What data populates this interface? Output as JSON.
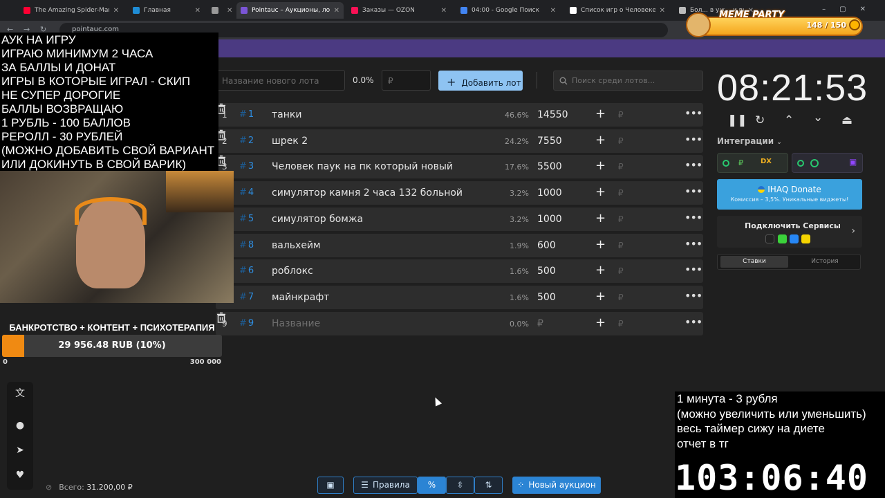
{
  "browser": {
    "tabs": [
      {
        "title": "The Amazing Spider-Man игра",
        "color": "#ff0033"
      },
      {
        "title": "Главная",
        "color": "#1f8dd6"
      },
      {
        "title": "",
        "color": "#999999"
      },
      {
        "title": "Pointauc – Аукционы, лотереи",
        "color": "#7b55d6",
        "active": true
      },
      {
        "title": "Заказы — OZON",
        "color": "#f91155"
      },
      {
        "title": "04:00 - Google Поиск",
        "color": "#4285f4"
      },
      {
        "title": "Список игр о Человеке-пауке",
        "color": "#ffffff"
      },
      {
        "title": "Бол... в уж... и выходные",
        "color": "#bbbbbb"
      }
    ],
    "url": "pointauc.com"
  },
  "overlay": {
    "lines": [
      "АУК НА ИГРУ",
      "ИГРАЮ МИНИМУМ 2 ЧАСА",
      "ЗА БАЛЛЫ И ДОНАТ",
      "ИГРЫ В КОТОРЫЕ ИГРАЛ - СКИП",
      "НЕ СУПЕР ДОРОГИЕ",
      "БАЛЛЫ ВОЗВРАЩАЮ",
      "1 РУБЛЬ - 100 БАЛЛОВ",
      "РЕРОЛЛ - 30 РУБЛЕЙ",
      "(МОЖНО ДОБАВИТЬ СВОЙ ВАРИАНТ",
      "ИЛИ ДОКИНУТЬ В СВОЙ ВАРИК)"
    ]
  },
  "donation_goal": {
    "title": "БАНКРОТСТВО + КОНТЕНТ + ПСИХОТЕРАПИЯ",
    "label": "29 956.48 RUB (10%)",
    "progress": 0.1,
    "min": "0",
    "max": "300 000"
  },
  "meme_party": {
    "title": "MEME PARTY",
    "count": "148 / 150"
  },
  "toolbar": {
    "new_lot_placeholder": "Название нового лота",
    "percent": "0.0%",
    "amount_placeholder": "₽",
    "add_lot": "Добавить лот",
    "search_placeholder": "Поиск среди лотов..."
  },
  "lots": [
    {
      "pos": "1",
      "id": "1",
      "name": "танки",
      "pct": "46.6%",
      "amount": "14550"
    },
    {
      "pos": "2",
      "id": "2",
      "name": "шрек 2",
      "pct": "24.2%",
      "amount": "7550"
    },
    {
      "pos": "3",
      "id": "3",
      "name": "Человек паук на пк который новый",
      "pct": "17.6%",
      "amount": "5500"
    },
    {
      "pos": "4",
      "id": "4",
      "name": "симулятор камня 2 часа 132 больной",
      "pct": "3.2%",
      "amount": "1000"
    },
    {
      "pos": "5",
      "id": "5",
      "name": "симулятор бомжа",
      "pct": "3.2%",
      "amount": "1000"
    },
    {
      "pos": "6",
      "id": "8",
      "name": "вальхейм",
      "pct": "1.9%",
      "amount": "600"
    },
    {
      "pos": "7",
      "id": "6",
      "name": "роблокс",
      "pct": "1.6%",
      "amount": "500"
    },
    {
      "pos": "8",
      "id": "7",
      "name": "майнкрафт",
      "pct": "1.6%",
      "amount": "500"
    },
    {
      "pos": "9",
      "id": "9",
      "name": "Название",
      "pct": "0.0%",
      "amount": "₽",
      "placeholder": true
    }
  ],
  "lot_currency": "₽",
  "timer": {
    "value": "08:21:53"
  },
  "integrations": {
    "label": "Интеграции",
    "ihaq_title": "IHAQ Donate",
    "ihaq_sub": "Комиссия – 3,5%. Уникальные виджеты!",
    "connect_title": "Подключить Сервисы",
    "tab_bets": "Ставки",
    "tab_history": "История"
  },
  "stream_rules": {
    "lines": [
      "1 минута - 3 рубля",
      "(можно увеличить или уменьшить)",
      "весь таймер сижу на диете",
      "отчет в тг"
    ],
    "big_timer": "103:06:40"
  },
  "footer": {
    "total_label": "Всего:",
    "total_value": "31.200,00 ₽",
    "rules": "Правила",
    "new_auction": "Новый аукцион"
  }
}
